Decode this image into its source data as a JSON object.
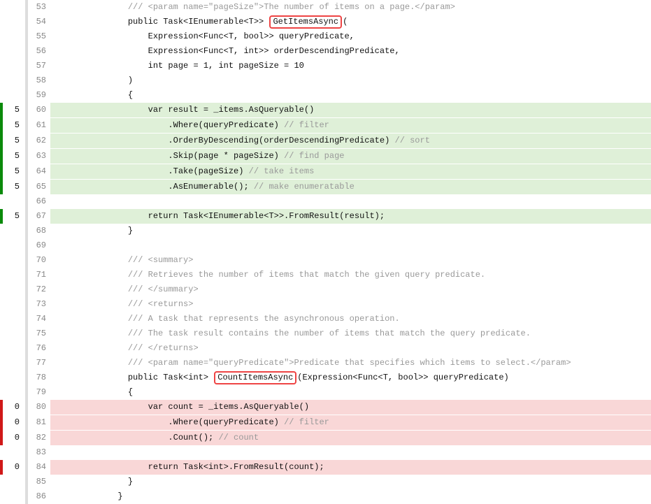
{
  "lines": [
    {
      "n": 53,
      "hits": null,
      "bar": null,
      "bg": null,
      "segs": [
        [
          "  ",
          null
        ],
        [
          "/// <param name=\"pageSize\">The number of items on a page.</param>",
          "comment"
        ]
      ]
    },
    {
      "n": 54,
      "hits": null,
      "bar": null,
      "bg": null,
      "segs": [
        [
          "  public Task<IEnumerable<T>> ",
          null
        ],
        [
          "GetItemsAsync",
          "hl"
        ],
        [
          "(",
          null
        ]
      ]
    },
    {
      "n": 55,
      "hits": null,
      "bar": null,
      "bg": null,
      "segs": [
        [
          "      Expression<Func<T, bool>> queryPredicate,",
          null
        ]
      ]
    },
    {
      "n": 56,
      "hits": null,
      "bar": null,
      "bg": null,
      "segs": [
        [
          "      Expression<Func<T, int>> orderDescendingPredicate,",
          null
        ]
      ]
    },
    {
      "n": 57,
      "hits": null,
      "bar": null,
      "bg": null,
      "segs": [
        [
          "      int page = 1, int pageSize = 10",
          null
        ]
      ]
    },
    {
      "n": 58,
      "hits": null,
      "bar": null,
      "bg": null,
      "segs": [
        [
          "  )",
          null
        ]
      ]
    },
    {
      "n": 59,
      "hits": null,
      "bar": null,
      "bg": null,
      "segs": [
        [
          "  {",
          null
        ]
      ]
    },
    {
      "n": 60,
      "hits": 5,
      "bar": "green",
      "bg": "green-sep",
      "segs": [
        [
          "      var result = _items.AsQueryable()",
          null
        ]
      ]
    },
    {
      "n": 61,
      "hits": 5,
      "bar": "green",
      "bg": "green-sep",
      "segs": [
        [
          "          .Where(queryPredicate) ",
          null
        ],
        [
          "// filter",
          "comment"
        ]
      ]
    },
    {
      "n": 62,
      "hits": 5,
      "bar": "green",
      "bg": "green-sep",
      "segs": [
        [
          "          .OrderByDescending(orderDescendingPredicate) ",
          null
        ],
        [
          "// sort",
          "comment"
        ]
      ]
    },
    {
      "n": 63,
      "hits": 5,
      "bar": "green",
      "bg": "green-sep",
      "segs": [
        [
          "          .Skip(page * pageSize) ",
          null
        ],
        [
          "// find page",
          "comment"
        ]
      ]
    },
    {
      "n": 64,
      "hits": 5,
      "bar": "green",
      "bg": "green-sep",
      "segs": [
        [
          "          .Take(pageSize) ",
          null
        ],
        [
          "// take items",
          "comment"
        ]
      ]
    },
    {
      "n": 65,
      "hits": 5,
      "bar": "green",
      "bg": "green",
      "segs": [
        [
          "          .AsEnumerable(); ",
          null
        ],
        [
          "// make enumeratable",
          "comment"
        ]
      ]
    },
    {
      "n": 66,
      "hits": null,
      "bar": null,
      "bg": null,
      "segs": [
        [
          "",
          null
        ]
      ]
    },
    {
      "n": 67,
      "hits": 5,
      "bar": "green",
      "bg": "green",
      "segs": [
        [
          "      return Task<IEnumerable<T>>.FromResult(result);",
          null
        ]
      ]
    },
    {
      "n": 68,
      "hits": null,
      "bar": null,
      "bg": null,
      "segs": [
        [
          "  }",
          null
        ]
      ]
    },
    {
      "n": 69,
      "hits": null,
      "bar": null,
      "bg": null,
      "segs": [
        [
          "",
          null
        ]
      ]
    },
    {
      "n": 70,
      "hits": null,
      "bar": null,
      "bg": null,
      "segs": [
        [
          "  ",
          null
        ],
        [
          "/// <summary>",
          "comment"
        ]
      ]
    },
    {
      "n": 71,
      "hits": null,
      "bar": null,
      "bg": null,
      "segs": [
        [
          "  ",
          null
        ],
        [
          "/// Retrieves the number of items that match the given query predicate.",
          "comment"
        ]
      ]
    },
    {
      "n": 72,
      "hits": null,
      "bar": null,
      "bg": null,
      "segs": [
        [
          "  ",
          null
        ],
        [
          "/// </summary>",
          "comment"
        ]
      ]
    },
    {
      "n": 73,
      "hits": null,
      "bar": null,
      "bg": null,
      "segs": [
        [
          "  ",
          null
        ],
        [
          "/// <returns>",
          "comment"
        ]
      ]
    },
    {
      "n": 74,
      "hits": null,
      "bar": null,
      "bg": null,
      "segs": [
        [
          "  ",
          null
        ],
        [
          "/// A task that represents the asynchronous operation.",
          "comment"
        ]
      ]
    },
    {
      "n": 75,
      "hits": null,
      "bar": null,
      "bg": null,
      "segs": [
        [
          "  ",
          null
        ],
        [
          "/// The task result contains the number of items that match the query predicate.",
          "comment"
        ]
      ]
    },
    {
      "n": 76,
      "hits": null,
      "bar": null,
      "bg": null,
      "segs": [
        [
          "  ",
          null
        ],
        [
          "/// </returns>",
          "comment"
        ]
      ]
    },
    {
      "n": 77,
      "hits": null,
      "bar": null,
      "bg": null,
      "segs": [
        [
          "  ",
          null
        ],
        [
          "/// <param name=\"queryPredicate\">Predicate that specifies which items to select.</param>",
          "comment"
        ]
      ]
    },
    {
      "n": 78,
      "hits": null,
      "bar": null,
      "bg": null,
      "segs": [
        [
          "  public Task<int> ",
          null
        ],
        [
          "CountItemsAsync",
          "hl"
        ],
        [
          "(Expression<Func<T, bool>> queryPredicate)",
          null
        ]
      ]
    },
    {
      "n": 79,
      "hits": null,
      "bar": null,
      "bg": null,
      "segs": [
        [
          "  {",
          null
        ]
      ]
    },
    {
      "n": 80,
      "hits": 0,
      "bar": "red",
      "bg": "red-sep",
      "segs": [
        [
          "      var count = _items.AsQueryable()",
          null
        ]
      ]
    },
    {
      "n": 81,
      "hits": 0,
      "bar": "red",
      "bg": "red-sep",
      "segs": [
        [
          "          .Where(queryPredicate) ",
          null
        ],
        [
          "// filter",
          "comment"
        ]
      ]
    },
    {
      "n": 82,
      "hits": 0,
      "bar": "red",
      "bg": "red",
      "segs": [
        [
          "          .Count(); ",
          null
        ],
        [
          "// count",
          "comment"
        ]
      ]
    },
    {
      "n": 83,
      "hits": null,
      "bar": null,
      "bg": null,
      "segs": [
        [
          "",
          null
        ]
      ]
    },
    {
      "n": 84,
      "hits": 0,
      "bar": "red",
      "bg": "red",
      "segs": [
        [
          "      return Task<int>.FromResult(count);",
          null
        ]
      ]
    },
    {
      "n": 85,
      "hits": null,
      "bar": null,
      "bg": null,
      "segs": [
        [
          "  }",
          null
        ]
      ]
    },
    {
      "n": 86,
      "hits": null,
      "bar": null,
      "bg": null,
      "segs": [
        [
          "}",
          null
        ]
      ]
    }
  ],
  "baseIndent": "            "
}
